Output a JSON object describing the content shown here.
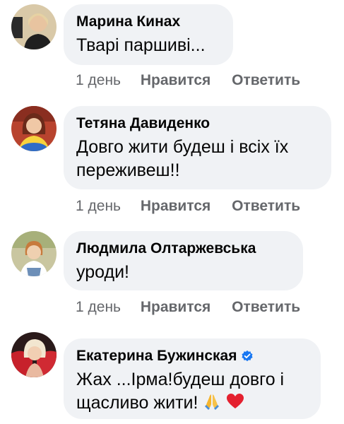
{
  "comments": [
    {
      "author": "Марина Кинах",
      "text": "Тварі паршиві...",
      "time": "1 день",
      "like": "Нравится",
      "reply": "Ответить"
    },
    {
      "author": "Тетяна Давиденко",
      "text_line1": "Довго жити будеш і всіх їх",
      "text_line2": "переживеш!!",
      "time": "1 день",
      "like": "Нравится",
      "reply": "Ответить"
    },
    {
      "author": "Людмила Олтаржевська",
      "text": "уроди!",
      "time": "1 день",
      "like": "Нравится",
      "reply": "Ответить"
    },
    {
      "author": "Екатерина Бужинская",
      "verified": true,
      "text_line1": "Жах ...Ірма!будеш довго і",
      "text_line2": "щасливо жити!",
      "emojis": [
        "folded-hands-icon",
        "red-heart-icon"
      ]
    }
  ],
  "colors": {
    "bubble": "#f0f2f5",
    "meta_text": "#65676b",
    "verified": "#1877f2"
  }
}
